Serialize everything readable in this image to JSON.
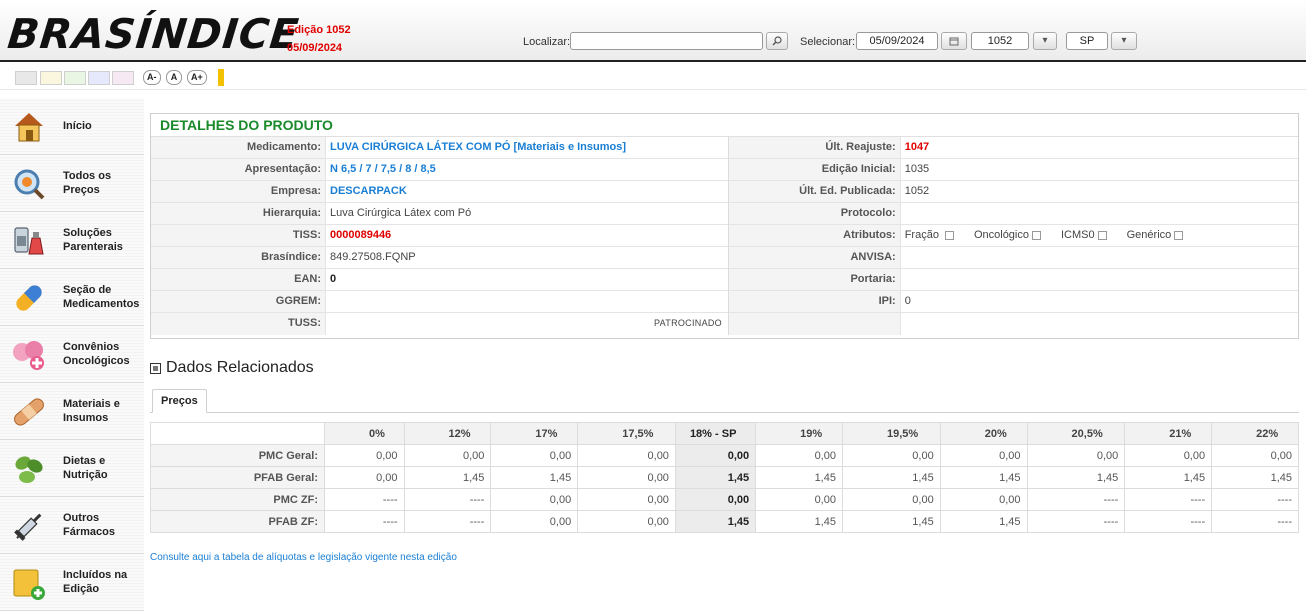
{
  "header": {
    "logo": "BRASÍNDICE",
    "edicao_label": "Edição 1052",
    "edicao_date": "05/09/2024",
    "localizar_label": "Localizar:",
    "localizar_value": "",
    "selecionar_label": "Selecionar:",
    "selected_date": "05/09/2024",
    "selected_edition": "1052",
    "selected_state": "SP"
  },
  "toolbar": {
    "swatches": [
      "#e8e8e8",
      "#fbf7de",
      "#eaf6e4",
      "#e6e8fb",
      "#f6e9f3"
    ],
    "font_decrease": "A-",
    "font_normal": "A",
    "font_increase": "A+"
  },
  "sidebar": {
    "items": [
      {
        "label": "Início",
        "icon": "home-icon"
      },
      {
        "label": "Todos os Preços",
        "icon": "magnifier-icon"
      },
      {
        "label": "Soluções Parenterais",
        "icon": "solution-bottles-icon"
      },
      {
        "label": "Seção de Medicamentos",
        "icon": "capsule-icon"
      },
      {
        "label": "Convênios Oncológicos",
        "icon": "pink-ribbon-icon"
      },
      {
        "label": "Materiais e Insumos",
        "icon": "bandage-icon"
      },
      {
        "label": "Dietas e Nutrição",
        "icon": "leaves-icon"
      },
      {
        "label": "Outros Fármacos",
        "icon": "syringe-icon"
      },
      {
        "label": "Incluídos na Edição",
        "icon": "new-item-icon"
      }
    ]
  },
  "details": {
    "title": "DETALHES DO PRODUTO",
    "left": [
      {
        "label": "Medicamento:",
        "value": "LUVA CIRÚRGICA LÁTEX COM PÓ [Materiais e Insumos]"
      },
      {
        "label": "Apresentação:",
        "value": "N 6,5 / 7 / 7,5 / 8 / 8,5"
      },
      {
        "label": "Empresa:",
        "value": "DESCARPACK"
      },
      {
        "label": "Hierarquia:",
        "value": "Luva Cirúrgica Látex com Pó"
      },
      {
        "label": "TISS:",
        "value": "0000089446"
      },
      {
        "label": "Brasíndice:",
        "value": "849.27508.FQNP"
      },
      {
        "label": "EAN:",
        "value": "0"
      },
      {
        "label": "GGREM:",
        "value": ""
      },
      {
        "label": "TUSS:",
        "value": ""
      }
    ],
    "sponsored_label": "PATROCINADO",
    "right": [
      {
        "label": "Últ. Reajuste:",
        "value": "1047"
      },
      {
        "label": "Edição Inicial:",
        "value": "1035"
      },
      {
        "label": "Últ. Ed. Publicada:",
        "value": "1052"
      },
      {
        "label": "Protocolo:",
        "value": ""
      },
      {
        "label": "Atributos:",
        "value": ""
      },
      {
        "label": "ANVISA:",
        "value": ""
      },
      {
        "label": "Portaria:",
        "value": ""
      },
      {
        "label": "IPI:",
        "value": "0"
      },
      {
        "label": "",
        "value": ""
      }
    ],
    "attributes": [
      "Fração",
      "Oncológico",
      "ICMS0",
      "Genérico"
    ]
  },
  "related": {
    "title": "Dados Relacionados",
    "tab": "Preços"
  },
  "prices": {
    "columns": [
      "0%",
      "12%",
      "17%",
      "17,5%",
      "18% - SP",
      "19%",
      "19,5%",
      "20%",
      "20,5%",
      "21%",
      "22%"
    ],
    "rows": [
      {
        "label": "PMC Geral:",
        "values": [
          "0,00",
          "0,00",
          "0,00",
          "0,00",
          "0,00",
          "0,00",
          "0,00",
          "0,00",
          "0,00",
          "0,00",
          "0,00"
        ]
      },
      {
        "label": "PFAB Geral:",
        "values": [
          "0,00",
          "1,45",
          "1,45",
          "0,00",
          "1,45",
          "1,45",
          "1,45",
          "1,45",
          "1,45",
          "1,45",
          "1,45"
        ]
      },
      {
        "label": "PMC ZF:",
        "values": [
          "----",
          "----",
          "0,00",
          "0,00",
          "0,00",
          "0,00",
          "0,00",
          "0,00",
          "----",
          "----",
          "----"
        ]
      },
      {
        "label": "PFAB ZF:",
        "values": [
          "----",
          "----",
          "0,00",
          "0,00",
          "1,45",
          "1,45",
          "1,45",
          "1,45",
          "----",
          "----",
          "----"
        ]
      }
    ]
  },
  "footer_link": "Consulte aqui a tabela de alíquotas e legislação vigente nesta edição",
  "colors": {
    "title_green": "#1a8a2a",
    "link_blue": "#1a7fd4",
    "alert_red": "#e00000"
  }
}
